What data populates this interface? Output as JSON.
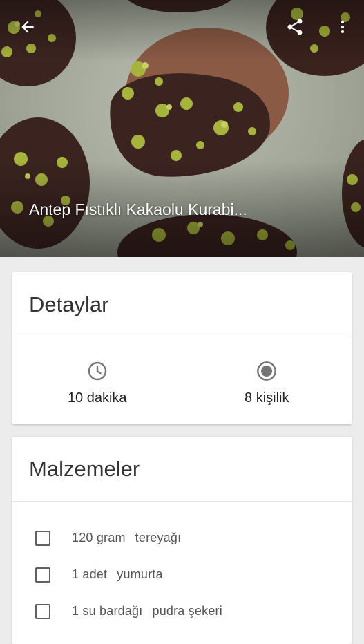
{
  "hero": {
    "title": "Antep Fıstıklı Kakaolu Kurabi...",
    "back_icon": "arrow-back-icon",
    "share_icon": "share-icon",
    "more_icon": "more-vert-icon"
  },
  "details": {
    "title": "Detaylar",
    "time": {
      "icon": "clock-icon",
      "label": "10 dakika"
    },
    "servings": {
      "icon": "radio-target-icon",
      "label": "8 kişilik"
    }
  },
  "ingredients": {
    "title": "Malzemeler",
    "items": [
      {
        "amount": "120 gram",
        "name": "tereyağı",
        "checked": false
      },
      {
        "amount": "1 adet",
        "name": "yumurta",
        "checked": false
      },
      {
        "amount": "1 su bardağı",
        "name": "pudra şekeri",
        "checked": false
      }
    ]
  },
  "colors": {
    "background": "#ececec",
    "card": "#ffffff",
    "hero_text": "#ffffff"
  }
}
